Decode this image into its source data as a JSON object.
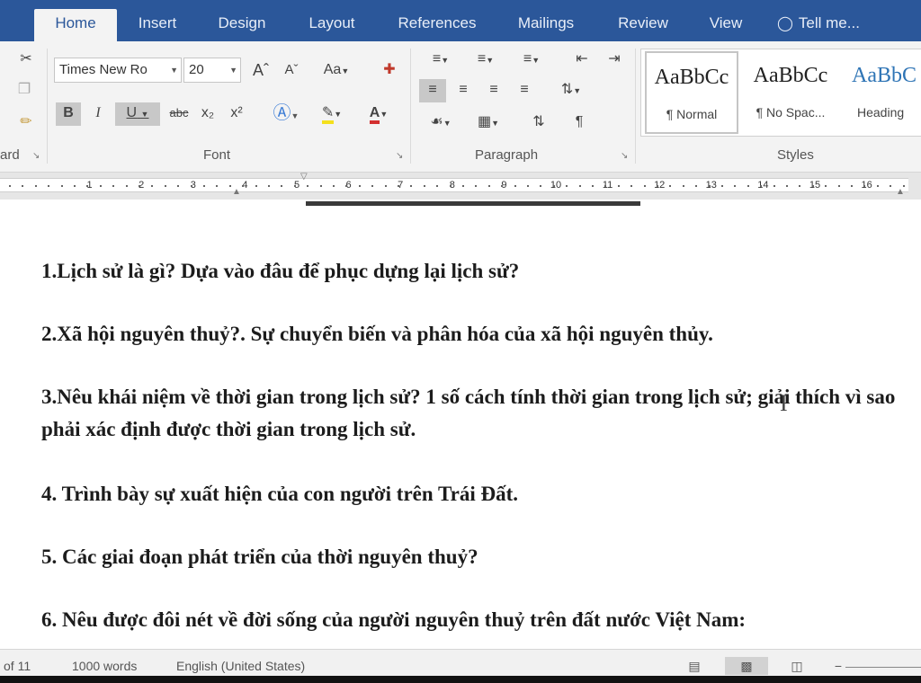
{
  "tabs": [
    {
      "label": "Home",
      "active": true
    },
    {
      "label": "Insert"
    },
    {
      "label": "Design"
    },
    {
      "label": "Layout"
    },
    {
      "label": "References"
    },
    {
      "label": "Mailings"
    },
    {
      "label": "Review"
    },
    {
      "label": "View"
    }
  ],
  "tell_me": "Tell me...",
  "ribbon": {
    "clipboard_label": "ard",
    "font": {
      "family": "Times New Ro",
      "size": "20",
      "grow": "Aˆ",
      "shrink": "Aˇ",
      "change_case": "Aa",
      "bold": "B",
      "italic": "I",
      "underline": "U",
      "strike": "abc",
      "subscript": "x₂",
      "superscript": "x²",
      "font_color": "A",
      "group_label": "Font"
    },
    "paragraph": {
      "group_label": "Paragraph",
      "pilcrow": "¶"
    },
    "styles": {
      "group_label": "Styles",
      "items": [
        {
          "sample": "AaBbCc",
          "name": "¶ Normal"
        },
        {
          "sample": "AaBbCc",
          "name": "¶ No Spac..."
        },
        {
          "sample": "AaBbC",
          "name": "Heading"
        }
      ]
    }
  },
  "ruler": {
    "numbers": [
      "1",
      "2",
      "3",
      "4",
      "5",
      "6",
      "7",
      "8",
      "9",
      "10",
      "11",
      "12",
      "13",
      "14",
      "15",
      "16"
    ]
  },
  "document": {
    "paragraphs": [
      "1.Lịch sử là gì? Dựa vào đâu để phục dựng lại lịch sử?",
      "2.Xã hội nguyên thuỷ?. Sự chuyển biến và phân hóa của xã hội nguyên thủy.",
      "3.Nêu khái niệm về thời gian trong lịch sử? 1 số cách tính thời gian trong lịch sử; giải thích vì sao phải xác định được thời gian trong lịch sử.",
      "4. Trình bày sự xuất hiện của con người trên Trái Đất.",
      "5. Các giai đoạn phát triển của thời nguyên thuỷ?",
      "6. Nêu được đôi nét về đời sống của người nguyên thuỷ trên đất nước Việt Nam:"
    ]
  },
  "status": {
    "page": "of 11",
    "words": "1000 words",
    "language": "English (United States)"
  },
  "colors": {
    "accent": "#2b579a",
    "ribbon": "#f3f3f3"
  }
}
